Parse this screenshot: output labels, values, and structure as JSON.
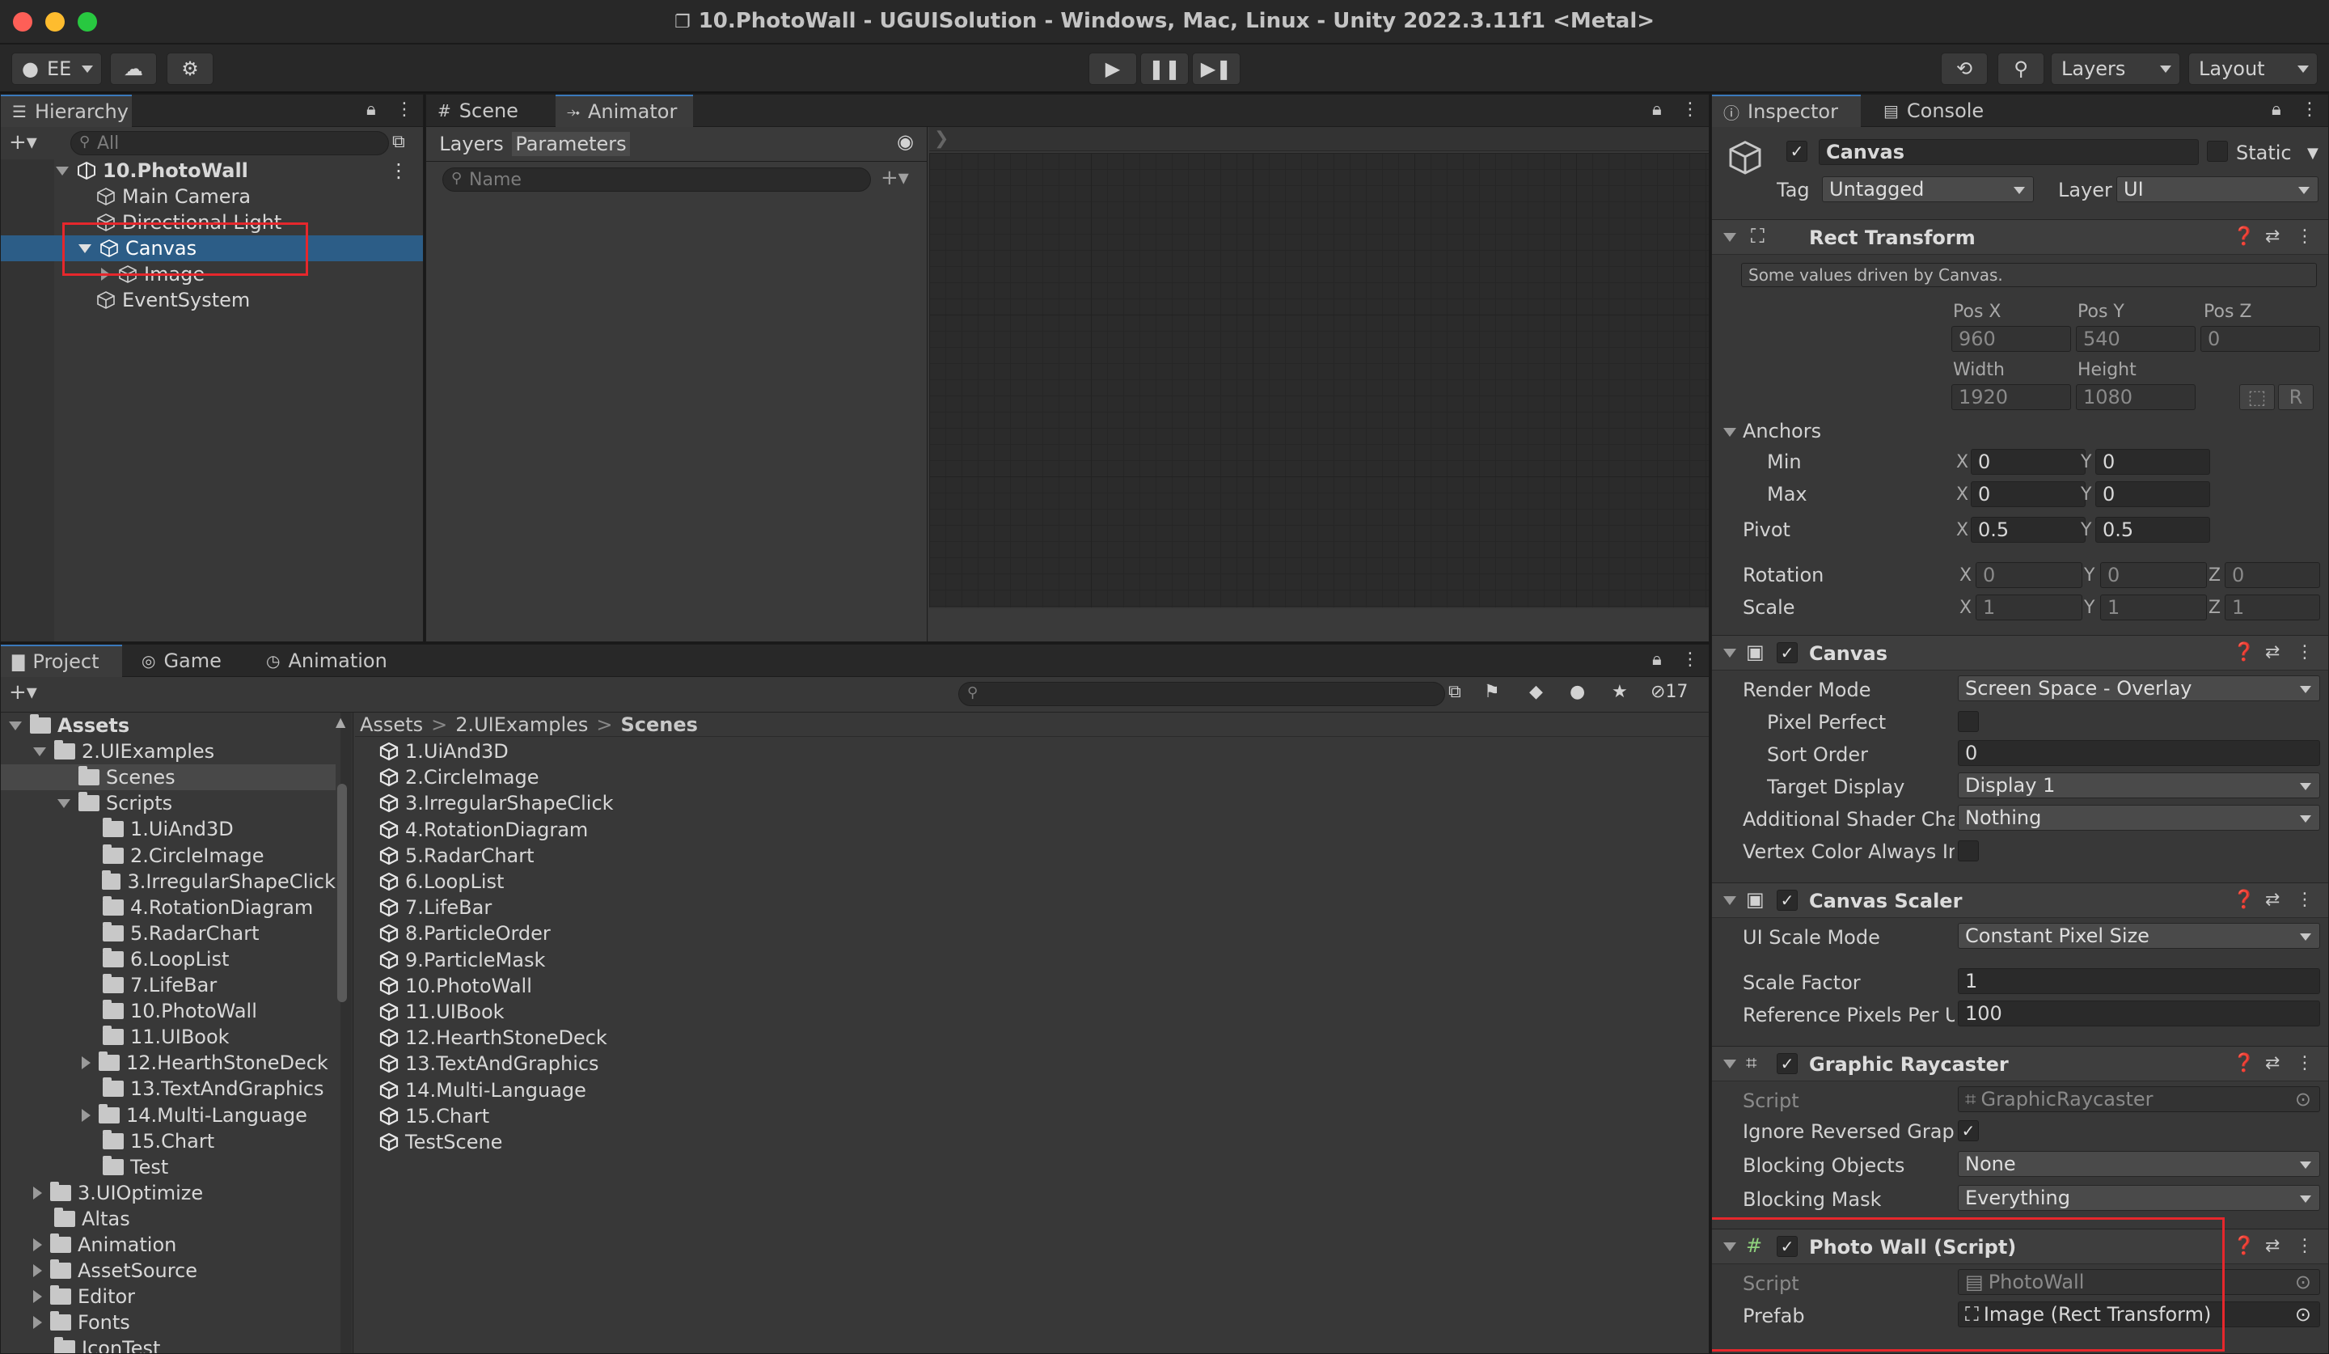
{
  "window": {
    "title": "10.PhotoWall - UGUISolution - Windows, Mac, Linux - Unity 2022.3.11f1 <Metal>"
  },
  "toolbar": {
    "account": "EE",
    "layers": "Layers",
    "layout": "Layout"
  },
  "hierarchy": {
    "tab": "Hierarchy",
    "search_placeholder": "All",
    "items": [
      {
        "label": "10.PhotoWall",
        "depth": 0
      },
      {
        "label": "Main Camera",
        "depth": 1
      },
      {
        "label": "Directional Light",
        "depth": 1
      },
      {
        "label": "Canvas",
        "depth": 1
      },
      {
        "label": "Image",
        "depth": 2
      },
      {
        "label": "EventSystem",
        "depth": 1
      }
    ]
  },
  "scene_tabs": {
    "scene": "Scene",
    "animator": "Animator"
  },
  "animator": {
    "layers": "Layers",
    "parameters": "Parameters",
    "name_placeholder": "Name"
  },
  "project": {
    "tabs": [
      "Project",
      "Game",
      "Animation"
    ],
    "badge": "17",
    "tree": [
      "Assets",
      "2.UIExamples",
      "Scenes",
      "Scripts",
      "1.UiAnd3D",
      "2.CircleImage",
      "3.IrregularShapeClick",
      "4.RotationDiagram",
      "5.RadarChart",
      "6.LoopList",
      "7.LifeBar",
      "10.PhotoWall",
      "11.UIBook",
      "12.HearthStoneDeck",
      "13.TextAndGraphics",
      "14.Multi-Language",
      "15.Chart",
      "Test",
      "3.UIOptimize",
      "Altas",
      "Animation",
      "AssetSource",
      "Editor",
      "Fonts",
      "IconTest"
    ],
    "breadcrumb": [
      "Assets",
      "2.UIExamples",
      "Scenes"
    ],
    "files": [
      "1.UiAnd3D",
      "2.CircleImage",
      "3.IrregularShapeClick",
      "4.RotationDiagram",
      "5.RadarChart",
      "6.LoopList",
      "7.LifeBar",
      "8.ParticleOrder",
      "9.ParticleMask",
      "10.PhotoWall",
      "11.UIBook",
      "12.HearthStoneDeck",
      "13.TextAndGraphics",
      "14.Multi-Language",
      "15.Chart",
      "TestScene"
    ]
  },
  "inspector": {
    "tabs": {
      "inspector": "Inspector",
      "console": "Console"
    },
    "object": {
      "name": "Canvas",
      "static": "Static",
      "tag_label": "Tag",
      "tag": "Untagged",
      "layer_label": "Layer",
      "layer": "UI"
    },
    "rect_transform": {
      "title": "Rect Transform",
      "note": "Some values driven by Canvas.",
      "pos_x_label": "Pos X",
      "pos_y_label": "Pos Y",
      "pos_z_label": "Pos Z",
      "pos_x": "960",
      "pos_y": "540",
      "pos_z": "0",
      "width_label": "Width",
      "height_label": "Height",
      "width": "1920",
      "height": "1080",
      "r_button": "R",
      "anchors": "Anchors",
      "min": "Min",
      "max": "Max",
      "min_x": "0",
      "min_y": "0",
      "max_x": "0",
      "max_y": "0",
      "pivot": "Pivot",
      "pivot_x": "0.5",
      "pivot_y": "0.5",
      "rotation": "Rotation",
      "rot_x": "0",
      "rot_y": "0",
      "rot_z": "0",
      "scale": "Scale",
      "scale_x": "1",
      "scale_y": "1",
      "scale_z": "1",
      "x": "X",
      "y": "Y",
      "z": "Z"
    },
    "canvas": {
      "title": "Canvas",
      "render_mode_label": "Render Mode",
      "render_mode": "Screen Space - Overlay",
      "pixel_perfect_label": "Pixel Perfect",
      "sort_order_label": "Sort Order",
      "sort_order": "0",
      "target_display_label": "Target Display",
      "target_display": "Display 1",
      "shader_channels_label": "Additional Shader Chan",
      "shader_channels": "Nothing",
      "vertex_color_label": "Vertex Color Always In"
    },
    "canvas_scaler": {
      "title": "Canvas Scaler",
      "scale_mode_label": "UI Scale Mode",
      "scale_mode": "Constant Pixel Size",
      "scale_factor_label": "Scale Factor",
      "scale_factor": "1",
      "ref_ppu_label": "Reference Pixels Per Ur",
      "ref_ppu": "100"
    },
    "graphic_raycaster": {
      "title": "Graphic Raycaster",
      "script_label": "Script",
      "script": "GraphicRaycaster",
      "ignore_reversed_label": "Ignore Reversed Graph",
      "blocking_objects_label": "Blocking Objects",
      "blocking_objects": "None",
      "blocking_mask_label": "Blocking Mask",
      "blocking_mask": "Everything"
    },
    "photo_wall": {
      "title": "Photo Wall (Script)",
      "script_label": "Script",
      "script": "PhotoWall",
      "prefab_label": "Prefab",
      "prefab": "Image (Rect Transform)"
    }
  },
  "colors": {
    "selection": "#2c5d87",
    "highlight_box": "#e6272c"
  }
}
